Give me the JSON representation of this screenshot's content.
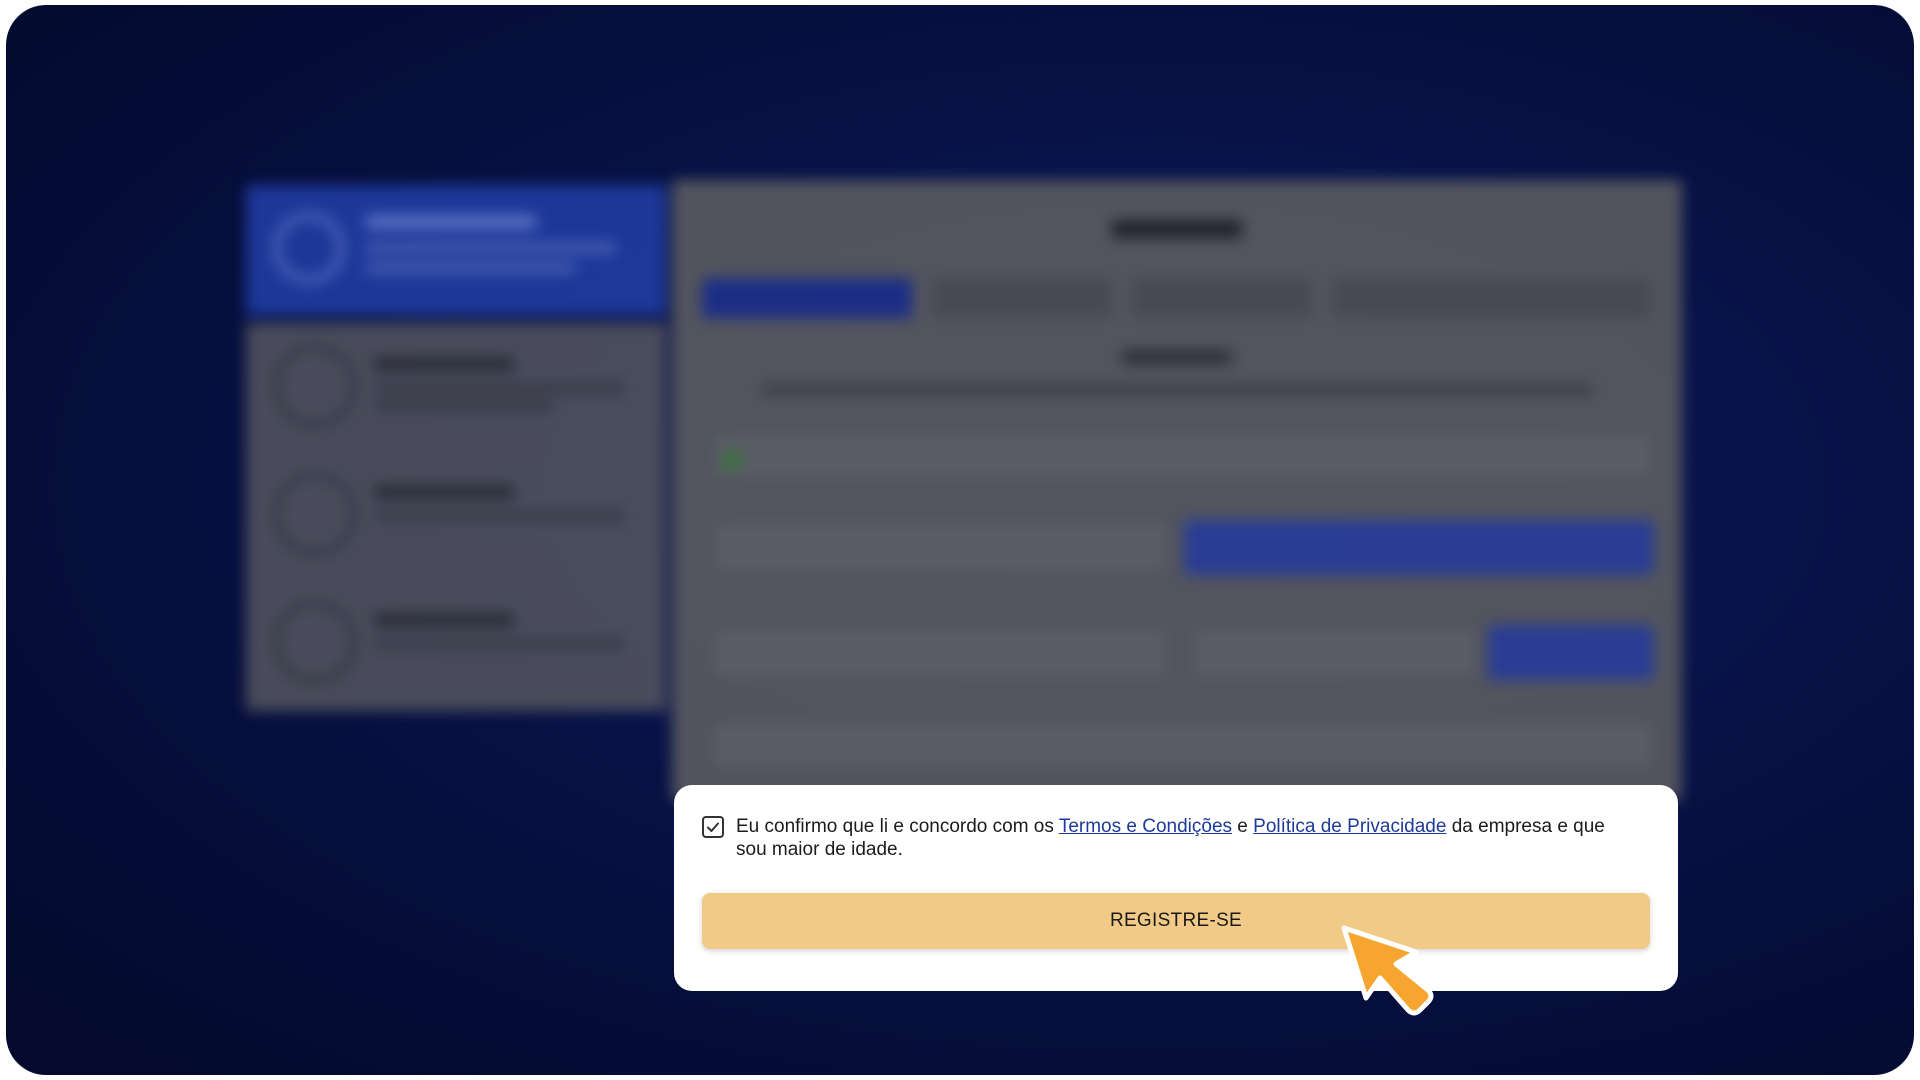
{
  "consent": {
    "text_before": "Eu confirmo que li e concordo com os ",
    "terms_link": "Termos e Condições",
    "text_middle": " e ",
    "privacy_link": "Política de Privacidade",
    "text_after": " da empresa e que sou maior de idade.",
    "checked": true
  },
  "register_button": {
    "label": "REGISTRE-SE"
  },
  "colors": {
    "background": "#081349",
    "card": "#ffffff",
    "button": "#f2ca87",
    "link": "#1e3a9a",
    "cursor": "#f7a531"
  },
  "icons": {
    "checkbox": "check-icon",
    "pointer": "cursor-arrow-icon"
  }
}
